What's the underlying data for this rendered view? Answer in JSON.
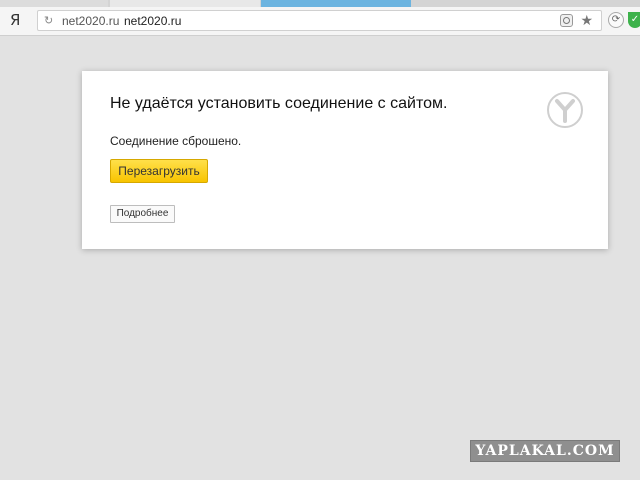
{
  "browser": {
    "logo": "Я",
    "address_bar": {
      "host": "net2020.ru",
      "url": "net2020.ru"
    },
    "icons": [
      "refresh-icon",
      "protect-icon",
      "star-icon",
      "sync-icon",
      "shield-icon"
    ]
  },
  "error_page": {
    "title": "Не удаётся установить соединение с сайтом.",
    "message": "Соединение сброшено.",
    "reload_label": "Перезагрузить",
    "details_label": "Подробнее"
  },
  "watermark": {
    "text": "YAPLAKAL.COM"
  },
  "colors": {
    "page_background": "#e2e2e2",
    "reload_button": "#f8c400",
    "active_tab": "#6cb4e0",
    "shield": "#3db24b"
  }
}
